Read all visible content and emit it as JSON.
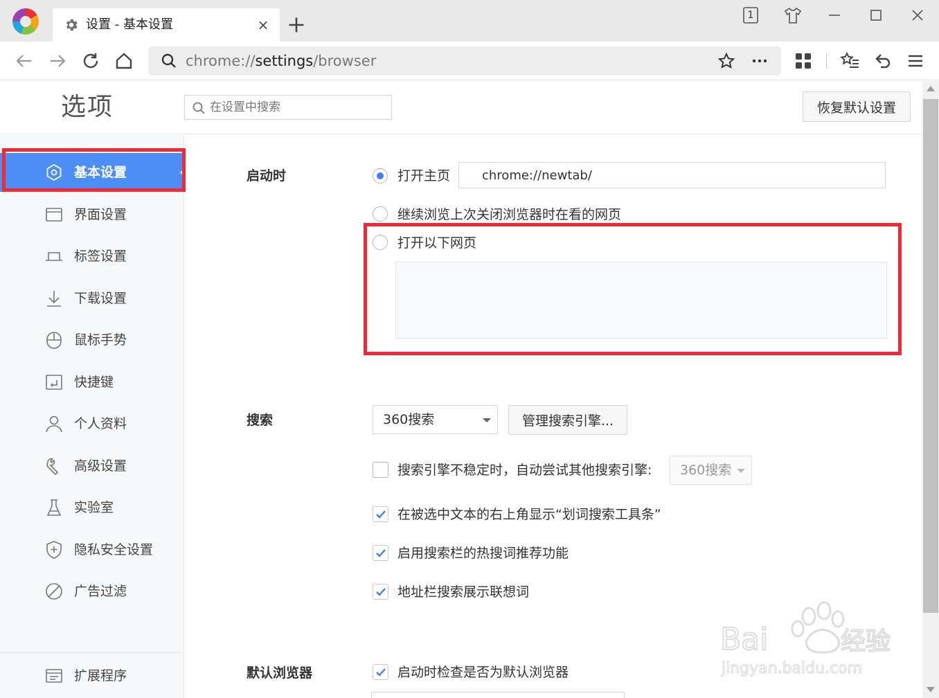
{
  "browser": {
    "tab_title": "设置 - 基本设置",
    "tab_close": "×",
    "tab_count": "1",
    "address": {
      "prefix": "chrome://",
      "host": "settings",
      "path": "/browser"
    }
  },
  "page": {
    "title": "选项",
    "search_placeholder": "在设置中搜索",
    "reset_label": "恢复默认设置"
  },
  "sidebar": {
    "items": [
      {
        "label": "基本设置",
        "icon": "basic-settings-icon",
        "active": true
      },
      {
        "label": "界面设置",
        "icon": "window-icon"
      },
      {
        "label": "标签设置",
        "icon": "tab-icon"
      },
      {
        "label": "下载设置",
        "icon": "download-icon"
      },
      {
        "label": "鼠标手势",
        "icon": "mouse-icon"
      },
      {
        "label": "快捷键",
        "icon": "shortcut-icon"
      },
      {
        "label": "个人资料",
        "icon": "person-icon"
      },
      {
        "label": "高级设置",
        "icon": "wrench-icon"
      },
      {
        "label": "实验室",
        "icon": "flask-icon"
      },
      {
        "label": "隐私安全设置",
        "icon": "shield-icon"
      },
      {
        "label": "广告过滤",
        "icon": "ad-block-icon"
      }
    ],
    "extensions_label": "扩展程序"
  },
  "startup": {
    "label": "启动时",
    "opt_homepage": "打开主页",
    "homepage_value": "chrome://newtab/",
    "opt_continue": "继续浏览上次关闭浏览器时在看的网页",
    "opt_pages": "打开以下网页",
    "selected": "homepage"
  },
  "search": {
    "label": "搜索",
    "engine": "360搜索",
    "manage_label": "管理搜索引擎...",
    "fallback_label": "搜索引擎不稳定时，自动尝试其他搜索引擎:",
    "fallback_engine": "360搜索",
    "fallback_checked": false,
    "selection_toolbar_label": "在被选中文本的右上角显示“划词搜索工具条”",
    "selection_toolbar_checked": true,
    "hot_words_label": "启用搜索栏的热搜词推荐功能",
    "hot_words_checked": true,
    "suggest_label": "地址栏搜索展示联想词",
    "suggest_checked": true
  },
  "default_browser": {
    "label": "默认浏览器",
    "check_label": "启动时检查是否为默认浏览器",
    "check_checked": true
  },
  "watermark": {
    "text": "Baidu经验",
    "sub": "jingyan.baidu.com"
  },
  "colors": {
    "accent": "#4c8ef6",
    "annotation": "#ef2a36",
    "check": "#3b82f6"
  }
}
